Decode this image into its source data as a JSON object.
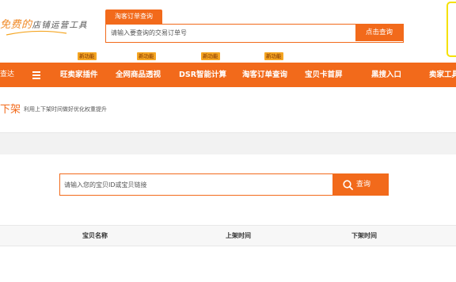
{
  "logo": {
    "text_part1": "免费的",
    "text_part2": "店铺运营工具"
  },
  "search": {
    "tab_label": "淘客订单查询",
    "placeholder": "请输入要查询的交易订单号",
    "button_label": "点击查询"
  },
  "badges": [
    "新功能",
    "新功能",
    "新功能",
    "新功能"
  ],
  "nav": {
    "first_label": "查达",
    "items": [
      "旺卖家插件",
      "全网商品透视",
      "DSR智能计算",
      "淘客订单查询",
      "宝贝卡首屏",
      "黑搜入口",
      "卖家工具"
    ]
  },
  "page": {
    "title": "下架",
    "description": "利用上下架时间做好优化权重提升"
  },
  "query": {
    "placeholder": "请输入您的宝贝ID或宝贝链接",
    "button_label": "查询"
  },
  "table": {
    "headers": [
      "宝贝名称",
      "上架时间",
      "下架时间"
    ]
  },
  "colors": {
    "accent": "#f26a1b",
    "badge": "#f5a623",
    "side_border": "#f5e100"
  },
  "icons": {
    "nav_menu": "list-icon",
    "query": "search-icon"
  }
}
